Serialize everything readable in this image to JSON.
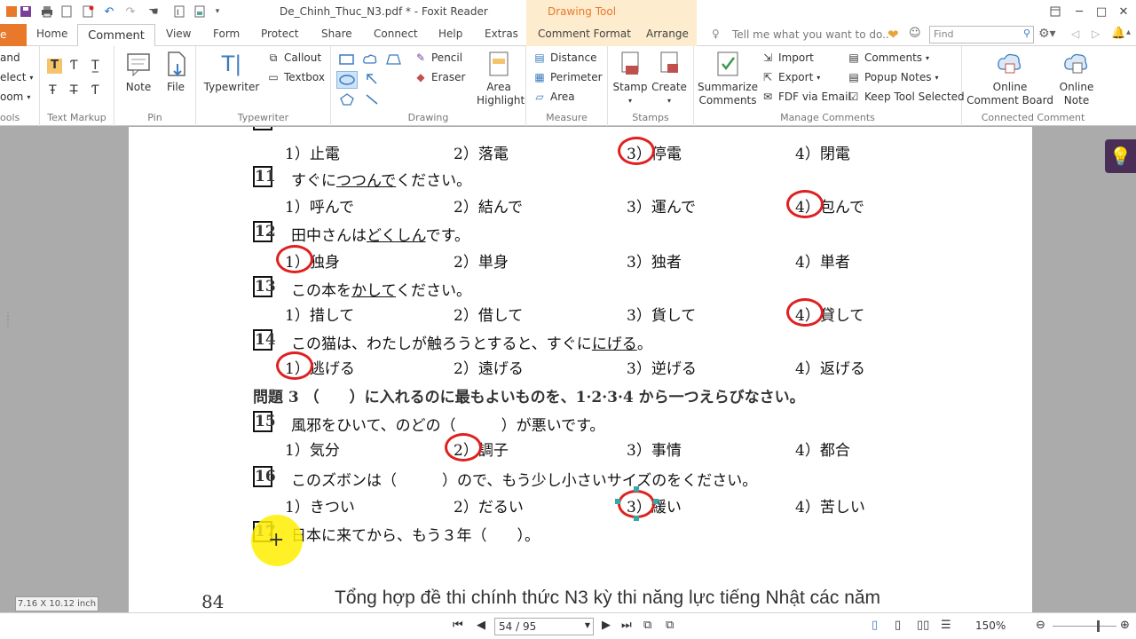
{
  "titlebar": {
    "title": "De_Chinh_Thuc_N3.pdf * - Foxit Reader",
    "drawing_tool": "Drawing Tool"
  },
  "tabs": {
    "file": "e",
    "items": [
      "Home",
      "Comment",
      "View",
      "Form",
      "Protect",
      "Share",
      "Connect",
      "Help",
      "Extras",
      "Comment Format",
      "Arrange"
    ],
    "tell_me": "Tell me what you want to do..",
    "find_placeholder": "Find"
  },
  "ribbon": {
    "tools": {
      "hand": "and",
      "select": "elect",
      "zoom": "oom",
      "label": "ools"
    },
    "text_markup": {
      "label": "Text Markup"
    },
    "pin": {
      "note": "Note",
      "file": "File",
      "label": "Pin"
    },
    "typewriter": {
      "typewriter": "Typewriter",
      "callout": "Callout",
      "textbox": "Textbox",
      "label": "Typewriter"
    },
    "drawing": {
      "pencil": "Pencil",
      "eraser": "Eraser",
      "area_highlight_1": "Area",
      "area_highlight_2": "Highlight",
      "label": "Drawing"
    },
    "measure": {
      "distance": "Distance",
      "perimeter": "Perimeter",
      "area": "Area",
      "label": "Measure"
    },
    "stamps": {
      "stamp": "Stamp",
      "create": "Create",
      "label": "Stamps"
    },
    "manage": {
      "summarize_1": "Summarize",
      "summarize_2": "Comments",
      "import": "Import",
      "export": "Export",
      "fdf_email": "FDF via Email",
      "comments": "Comments",
      "popup_notes": "Popup Notes",
      "keep_tool": "Keep Tool Selected",
      "label": "Manage Comments"
    },
    "connected": {
      "board_1": "Online",
      "board_2": "Comment Board",
      "note_1": "Online",
      "note_2": "Note",
      "label": "Connected Comment"
    }
  },
  "document": {
    "rows": [
      {
        "kind": "options",
        "opts": [
          "1）止電",
          "2）落電",
          "3）停電",
          "4）閉電"
        ],
        "circled": 3
      },
      {
        "kind": "question",
        "num": "11",
        "pre": "すぐに",
        "under": "つつんで",
        "post": "ください。"
      },
      {
        "kind": "options",
        "opts": [
          "1）呼んで",
          "2）結んで",
          "3）運んで",
          "4）包んで"
        ],
        "circled": 4
      },
      {
        "kind": "question",
        "num": "12",
        "pre": "田中さんは",
        "under": "どくしん",
        "post": "です。"
      },
      {
        "kind": "options",
        "opts": [
          "1）独身",
          "2）単身",
          "3）独者",
          "4）単者"
        ],
        "circled": 1
      },
      {
        "kind": "question",
        "num": "13",
        "pre": "この本を",
        "under": "かして",
        "post": "ください。"
      },
      {
        "kind": "options",
        "opts": [
          "1）措して",
          "2）借して",
          "3）貨して",
          "4）貸して"
        ],
        "circled": 4
      },
      {
        "kind": "question",
        "num": "14",
        "pre": "この猫は、わたしが触ろうとすると、すぐに",
        "under": "にげる",
        "post": "。"
      },
      {
        "kind": "options",
        "opts": [
          "1）逃げる",
          "2）遠げる",
          "3）逆げる",
          "4）返げる"
        ],
        "circled": 1
      },
      {
        "kind": "section",
        "text": "問題 3 （　　）に入れるのに最もよいものを、1·2·3·4 から一つえらびなさい。"
      },
      {
        "kind": "question",
        "num": "15",
        "pre": "風邪をひいて、のどの（　　　）が悪いです。",
        "under": "",
        "post": ""
      },
      {
        "kind": "options",
        "opts": [
          "1）気分",
          "2）調子",
          "3）事情",
          "4）都合"
        ],
        "circled": 2
      },
      {
        "kind": "question",
        "num": "16",
        "pre": "このズボンは（　　　）ので、もう少し小さいサイズのをください。",
        "under": "",
        "post": ""
      },
      {
        "kind": "options",
        "opts": [
          "1）きつい",
          "2）だるい",
          "3）緩い",
          "4）苦しい"
        ],
        "circled": 3
      },
      {
        "kind": "question",
        "num": "17",
        "pre": "日本に来てから、もう３年（　　）。",
        "under": "",
        "post": ""
      }
    ],
    "page_number": "84",
    "footer": "Tổng hợp đề thi chính thức N3 kỳ thi năng lực tiếng Nhật các năm",
    "page_size": "7.16 X 10.12 inch"
  },
  "status": {
    "page_field": "54 / 95",
    "zoom": "150%"
  },
  "colors": {
    "accent": "#e8792b",
    "annotation": "#e02020",
    "highlight": "#ffee00"
  }
}
